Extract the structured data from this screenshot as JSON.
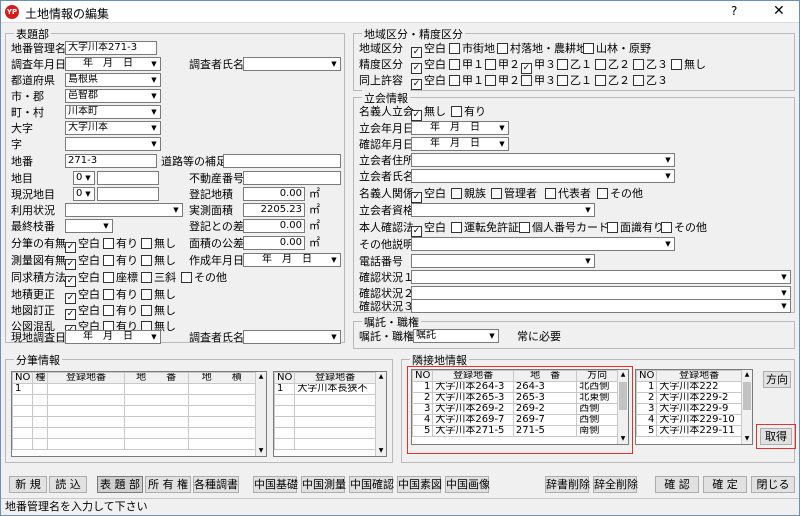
{
  "window": {
    "title": "土地情報の編集",
    "help": "?",
    "close": "✕",
    "app_icon_text": "YP"
  },
  "hyodaibu": {
    "group_title": "表題部",
    "chiban_kanri_label": "地番管理名",
    "chiban_kanri_value": "大字川本271-3",
    "chosa_date_label": "調査年月日",
    "chosa_date_value": "年　月　日",
    "chosasha_label": "調査者氏名",
    "todofuken_label": "都道府県",
    "todofuken_value": "島根県",
    "shigun_label": "市・郡",
    "shigun_value": "邑智郡",
    "chouson_label": "町・村",
    "chouson_value": "川本町",
    "oaza_label": "大字",
    "oaza_value": "大字川本",
    "aza_label": "字",
    "chiban_label": "地番",
    "chiban_value": "271-3",
    "doro_label": "道路等の補足",
    "chimoku_label": "地目",
    "chimoku_value": "0",
    "fudosan_label": "不動産番号",
    "genkyo_label": "現況地目",
    "genkyo_value": "0",
    "toki_menseki_label": "登記地積",
    "toki_menseki_value": "0.00",
    "unit_m2": "㎡",
    "riyo_label": "利用状況",
    "jissoku_label": "実測面積",
    "jissoku_value": "2205.23",
    "saishu_label": "最終枝番",
    "toki_sa_label": "登記との差",
    "toki_sa_value": "0.00",
    "bunkatsu_label": "分筆の有無",
    "menseki_kosa_label": "面積の公差",
    "menseki_kosa_value": "0.00",
    "sokuryo_label": "測量図有無",
    "sakusei_label": "作成年月日",
    "sakusei_value": "年　月　日",
    "dokyoku_label": "同求積方法",
    "opt_kuuhaku": "空白",
    "opt_ari": "有り",
    "opt_nashi": "無し",
    "opt_zahyo": "座標",
    "opt_sankyaku": "三斜",
    "opt_sonota": "その他",
    "chiseki_kosei_label": "地積更正",
    "chizu_teisei_label": "地図訂正",
    "kozu_label": "公図混乱",
    "genchi_label": "現地調査日",
    "genchi_value": "年　月　日",
    "chosasha2_label": "調査者氏名"
  },
  "chiiki": {
    "group_title": "地域区分・精度区分",
    "chiiki_label": "地域区分",
    "seido_label": "精度区分",
    "dojyo_label": "同上許容",
    "chiiki_opts": [
      "空白",
      "市街地",
      "村落地・農耕地",
      "山林・原野"
    ],
    "seido_opts": [
      "空白",
      "甲１",
      "甲２",
      "甲３",
      "乙１",
      "乙２",
      "乙３",
      "無し"
    ],
    "dojyo_opts": [
      "空白",
      "甲１",
      "甲２",
      "甲３",
      "乙１",
      "乙２",
      "乙３"
    ]
  },
  "tachiai": {
    "group_title": "立会情報",
    "meigi_label": "名義人立会",
    "meigi_opts": [
      "無し",
      "有り"
    ],
    "tachiai_date_label": "立会年月日",
    "tachiai_date_value": "年　月　日",
    "kakunin_date_label": "確認年月日",
    "kakunin_date_value": "年　月　日",
    "address_label": "立会者住所",
    "name_label": "立会者氏名",
    "kankei_label": "名義人関係",
    "kankei_opts": [
      "空白",
      "親族",
      "管理者",
      "代表者",
      "その他"
    ],
    "shikaku_label": "立会者資格",
    "honnin_label": "本人確認法",
    "honnin_opts": [
      "空白",
      "運転免許証",
      "個人番号カード",
      "面識有り",
      "その他"
    ],
    "sonota_label": "その他説明",
    "tel_label": "電話番号",
    "status1_label": "確認状況１",
    "status2_label": "確認状況２",
    "status3_label": "確認状況３"
  },
  "shokutaku": {
    "group_title": "嘱託・職権",
    "label": "嘱託・職権",
    "value": "嘱託",
    "note": "常に必要"
  },
  "bunpitsu": {
    "group_title": "分筆情報",
    "headers": [
      "NO",
      "種",
      "登録地番",
      "地　　番",
      "地　　積"
    ],
    "rows": [
      [
        "1",
        "",
        "",
        "",
        ""
      ]
    ],
    "sub_headers": [
      "NO",
      "登録地番"
    ],
    "sub_rows": [
      [
        "1",
        "大字川本長狭不"
      ]
    ]
  },
  "rinsetsu": {
    "group_title": "隣接地情報",
    "headers": [
      "NO",
      "登録地番",
      "地　番",
      "方向"
    ],
    "rows": [
      [
        "1",
        "大字川本264-3",
        "264-3",
        "北西側"
      ],
      [
        "2",
        "大字川本265-3",
        "265-3",
        "北東側"
      ],
      [
        "3",
        "大字川本269-2",
        "269-2",
        "西側"
      ],
      [
        "4",
        "大字川本269-7",
        "269-7",
        "西側"
      ],
      [
        "5",
        "大字川本271-5",
        "271-5",
        "南側"
      ]
    ],
    "sub_headers": [
      "NO",
      "登録地番"
    ],
    "sub_rows": [
      [
        "1",
        "大字川本222"
      ],
      [
        "2",
        "大字川本229-2"
      ],
      [
        "3",
        "大字川本229-9"
      ],
      [
        "4",
        "大字川本229-10"
      ],
      [
        "5",
        "大字川本229-11"
      ]
    ],
    "direction_button": "方向",
    "get_button": "取得"
  },
  "toolbar": {
    "shinki": "新 規",
    "yomikomi": "読 込",
    "hyodaibu": "表 題 部",
    "shoyuken": "所 有 権",
    "kakushu": "各種調書",
    "chugoku_kiso": "中国基礎",
    "chugoku_sokuryo": "中国測量",
    "chugoku_kakunin": "中国確認",
    "chugoku_sozu": "中国素図",
    "chugoku_gazo": "中国画像",
    "jisho_sakujo": "辞書削除",
    "zen_sakujo": "辞全削除",
    "kakunin": "確 認",
    "kakutei": "確 定",
    "tojiru": "閉じる"
  },
  "status_text": "地番管理名を入力して下さい"
}
